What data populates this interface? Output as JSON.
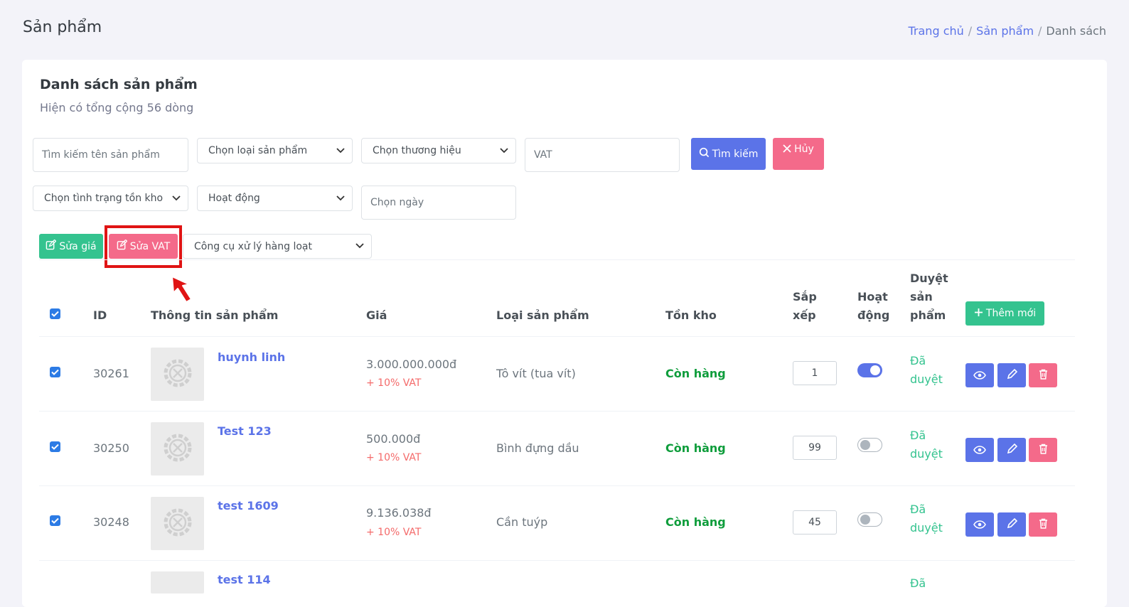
{
  "header": {
    "title": "Sản phẩm",
    "breadcrumb": [
      "Trang chủ",
      "Sản phẩm",
      "Danh sách"
    ]
  },
  "card": {
    "title": "Danh sách sản phẩm",
    "subtitle": "Hiện có tổng cộng 56 dòng"
  },
  "filters": {
    "search_placeholder": "Tìm kiếm tên sản phẩm",
    "category_select": "Chọn loại sản phẩm",
    "brand_select": "Chọn thương hiệu",
    "vat_placeholder": "VAT",
    "search_button": "Tìm kiếm",
    "cancel_button": "Hủy",
    "stock_select": "Chọn tình trạng tồn kho",
    "status_select": "Hoạt động",
    "date_placeholder": "Chọn ngày"
  },
  "toolbar": {
    "edit_price": "Sửa giá",
    "edit_vat": "Sửa VAT",
    "bulk_tools": "Công cụ xử lý hàng loạt"
  },
  "table": {
    "headers": {
      "id": "ID",
      "info": "Thông tin sản phẩm",
      "price": "Giá",
      "category": "Loại sản phẩm",
      "stock": "Tồn kho",
      "sort_1": "Sắp",
      "sort_2": "xếp",
      "active_1": "Hoạt",
      "active_2": "động",
      "approve_1": "Duyệt",
      "approve_2": "sản",
      "approve_3": "phẩm"
    },
    "add_button": "Thêm mới",
    "rows": [
      {
        "id": "30261",
        "name": "huynh linh",
        "price": "3.000.000.000đ",
        "vat": "+ 10% VAT",
        "category": "Tô vít (tua vít)",
        "stock": "Còn hàng",
        "sort": "1",
        "active": true,
        "approved_1": "Đã",
        "approved_2": "duyệt"
      },
      {
        "id": "30250",
        "name": "Test 123",
        "price": "500.000đ",
        "vat": "+ 10% VAT",
        "category": "Bình đựng dầu",
        "stock": "Còn hàng",
        "sort": "99",
        "active": false,
        "approved_1": "Đã",
        "approved_2": "duyệt"
      },
      {
        "id": "30248",
        "name": "test 1609",
        "price": "9.136.038đ",
        "vat": "+ 10% VAT",
        "category": "Cần tuýp",
        "stock": "Còn hàng",
        "sort": "45",
        "active": false,
        "approved_1": "Đã",
        "approved_2": "duyệt"
      },
      {
        "name": "test 114",
        "approved_1": "Đã"
      }
    ]
  },
  "colors": {
    "primary": "#5b73e8",
    "danger": "#f46a8a",
    "success": "#34c38f",
    "stock_green": "#0f9d3c",
    "highlight_red": "#e01414"
  }
}
